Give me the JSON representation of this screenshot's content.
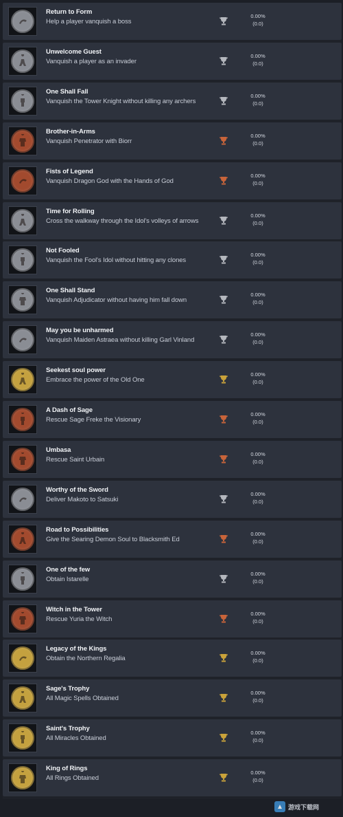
{
  "colors": {
    "silver": "#b4b7bd",
    "bronze": "#c8643a",
    "gold": "#c9a23a",
    "coin_silver": "#8a8d94",
    "coin_bronze": "#a24a2e",
    "coin_gold": "#c4a13f"
  },
  "achievements": [
    {
      "title": "Return to Form",
      "desc": "Help a player vanquish a boss",
      "tier": "silver",
      "icon": "figure-lying-icon",
      "percent": "0.00%",
      "count": "(0.0)"
    },
    {
      "title": "Unwelcome Guest",
      "desc": "Vanquish a player as an invader",
      "tier": "silver",
      "icon": "kneeling-figure-icon",
      "percent": "0.00%",
      "count": "(0.0)"
    },
    {
      "title": "One Shall Fall",
      "desc": "Vanquish the Tower Knight without killing any archers",
      "tier": "silver",
      "icon": "knight-figure-icon",
      "percent": "0.00%",
      "count": "(0.0)"
    },
    {
      "title": "Brother-in-Arms",
      "desc": "Vanquish Penetrator with Biorr",
      "tier": "bronze",
      "icon": "warrior-figure-icon",
      "percent": "0.00%",
      "count": "(0.0)"
    },
    {
      "title": "Fists of Legend",
      "desc": "Vanquish Dragon God with the Hands of God",
      "tier": "bronze",
      "icon": "fist-figure-icon",
      "percent": "0.00%",
      "count": "(0.0)"
    },
    {
      "title": "Time for Rolling",
      "desc": "Cross the walkway through the Idol's volleys of arrows",
      "tier": "silver",
      "icon": "rolling-figure-icon",
      "percent": "0.00%",
      "count": "(0.0)"
    },
    {
      "title": "Not Fooled",
      "desc": "Vanquish the Fool's Idol without hitting any clones",
      "tier": "silver",
      "icon": "idol-figure-icon",
      "percent": "0.00%",
      "count": "(0.0)"
    },
    {
      "title": "One Shall Stand",
      "desc": "Vanquish Adjudicator without having him fall down",
      "tier": "silver",
      "icon": "bird-figure-icon",
      "percent": "0.00%",
      "count": "(0.0)"
    },
    {
      "title": "May you be unharmed",
      "desc": "Vanquish Maiden Astraea without killing Garl Vinland",
      "tier": "silver",
      "icon": "maiden-figure-icon",
      "percent": "0.00%",
      "count": "(0.0)"
    },
    {
      "title": "Seekest soul power",
      "desc": "Embrace the power of the Old One",
      "tier": "gold",
      "icon": "soul-figure-icon",
      "percent": "0.00%",
      "count": "(0.0)"
    },
    {
      "title": "A Dash of Sage",
      "desc": "Rescue Sage Freke the Visionary",
      "tier": "bronze",
      "icon": "sage-figure-icon",
      "percent": "0.00%",
      "count": "(0.0)"
    },
    {
      "title": "Umbasa",
      "desc": "Rescue Saint Urbain",
      "tier": "bronze",
      "icon": "saint-figure-icon",
      "percent": "0.00%",
      "count": "(0.0)"
    },
    {
      "title": "Worthy of the Sword",
      "desc": "Deliver Makoto to Satsuki",
      "tier": "silver",
      "icon": "swordsman-figure-icon",
      "percent": "0.00%",
      "count": "(0.0)"
    },
    {
      "title": "Road to Possibilities",
      "desc": "Give the Searing Demon Soul to Blacksmith Ed",
      "tier": "bronze",
      "icon": "blacksmith-figure-icon",
      "percent": "0.00%",
      "count": "(0.0)"
    },
    {
      "title": "One of the few",
      "desc": "Obtain Istarelle",
      "tier": "silver",
      "icon": "spear-icon",
      "percent": "0.00%",
      "count": "(0.0)"
    },
    {
      "title": "Witch in the Tower",
      "desc": "Rescue Yuria the Witch",
      "tier": "bronze",
      "icon": "witch-figure-icon",
      "percent": "0.00%",
      "count": "(0.0)"
    },
    {
      "title": "Legacy of the Kings",
      "desc": "Obtain the Northern Regalia",
      "tier": "gold",
      "icon": "regalia-sword-icon",
      "percent": "0.00%",
      "count": "(0.0)"
    },
    {
      "title": "Sage's Trophy",
      "desc": "All Magic Spells Obtained",
      "tier": "gold",
      "icon": "scroll-icon",
      "percent": "0.00%",
      "count": "(0.0)"
    },
    {
      "title": "Saint's Trophy",
      "desc": "All Miracles Obtained",
      "tier": "gold",
      "icon": "talisman-icon",
      "percent": "0.00%",
      "count": "(0.0)"
    },
    {
      "title": "King of Rings",
      "desc": "All Rings Obtained",
      "tier": "gold",
      "icon": "ring-icon",
      "percent": "0.00%",
      "count": "(0.0)"
    }
  ],
  "watermark": {
    "text": "游戏下载网",
    "icon": "site-logo-icon"
  }
}
